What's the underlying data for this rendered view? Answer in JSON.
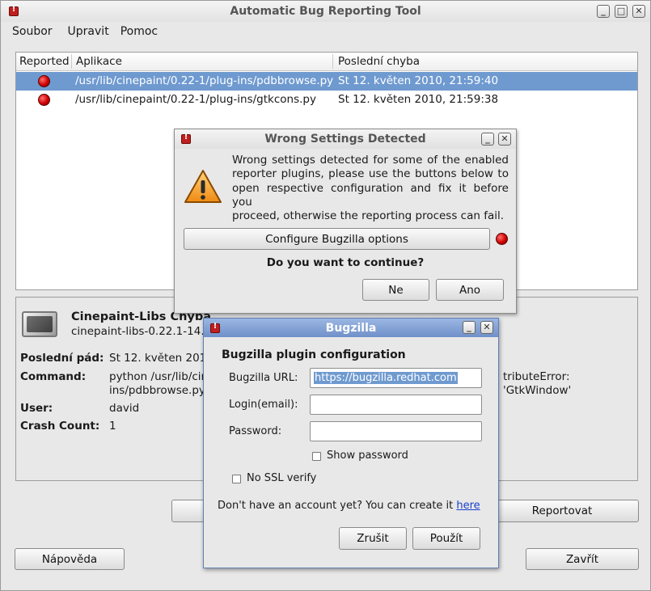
{
  "main": {
    "title": "Automatic Bug Reporting Tool",
    "menu": [
      "Soubor",
      "Upravit",
      "Pomoc"
    ],
    "columns": [
      "Reported",
      "Aplikace",
      "Poslední chyba"
    ],
    "rows": [
      {
        "app": "/usr/lib/cinepaint/0.22-1/plug-ins/pdbbrowse.py",
        "date": "St 12. květen 2010, 21:59:40"
      },
      {
        "app": "/usr/lib/cinepaint/0.22-1/plug-ins/gtkcons.py",
        "date": "St 12. květen 2010, 21:59:38"
      }
    ],
    "detail": {
      "name": "Cinepaint-Libs Chyba",
      "package": "cinepaint-libs-0.22.1-14.",
      "last_crash_label": "Poslední pád:",
      "last_crash_value": "St 12. květen 201",
      "command_label": "Command:",
      "command_line1": "python /usr/lib/cir",
      "command_line2": "ins/pdbbrowse.py",
      "reason_line1": "tributeError:",
      "reason_line2": "'GtkWindow'",
      "user_label": "User:",
      "user_value": "david",
      "crash_count_label": "Crash Count:",
      "crash_count_value": "1"
    },
    "report_button": "Reportovat",
    "help_button": "Nápověda",
    "close_button": "Zavřít"
  },
  "warning": {
    "title": "Wrong Settings Detected",
    "message_lines": [
      "Wrong settings detected for some of the enabled",
      "reporter plugins, please use the buttons below to",
      "open respective configuration and fix it before you",
      "proceed, otherwise the reporting process can fail."
    ],
    "configure_button": "Configure Bugzilla options",
    "question": "Do you want to continue?",
    "no_button": "Ne",
    "yes_button": "Ano"
  },
  "bugzilla": {
    "title": "Bugzilla",
    "heading": "Bugzilla plugin configuration",
    "url_label": "Bugzilla URL:",
    "url_value": "https://bugzilla.redhat.com",
    "login_label": "Login(email):",
    "login_value": "",
    "password_label": "Password:",
    "password_value": "",
    "show_password": "Show password",
    "no_ssl": "No SSL verify",
    "account_text": "Don't have an account yet? You can create it ",
    "account_link": "here",
    "cancel_button": "Zrušit",
    "apply_button": "Použít"
  },
  "colors": {
    "selection": "#6f9ad0",
    "titlebar": "#e9e9e9",
    "active_titlebar": "#7c9bd1",
    "error_red": "#d00000"
  },
  "icons": [
    "app-error-icon",
    "minimize-icon",
    "maximize-icon",
    "close-icon",
    "warning-icon",
    "red-dot-icon",
    "package-icon"
  ]
}
